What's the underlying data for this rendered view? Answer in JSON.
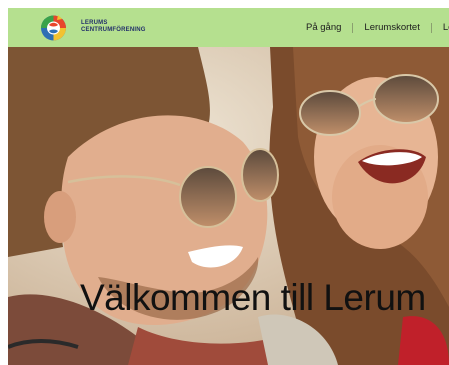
{
  "brand": {
    "line1": "LERUMS",
    "line2": "CENTRUMFÖRENING"
  },
  "nav": {
    "items": [
      {
        "label": "På gång"
      },
      {
        "label": "Lerumskortet"
      },
      {
        "label": "Le"
      }
    ]
  },
  "hero": {
    "title": "Välkommen till Lerum"
  },
  "colors": {
    "header_bg": "#b5e08f",
    "brand_text": "#23306a"
  }
}
